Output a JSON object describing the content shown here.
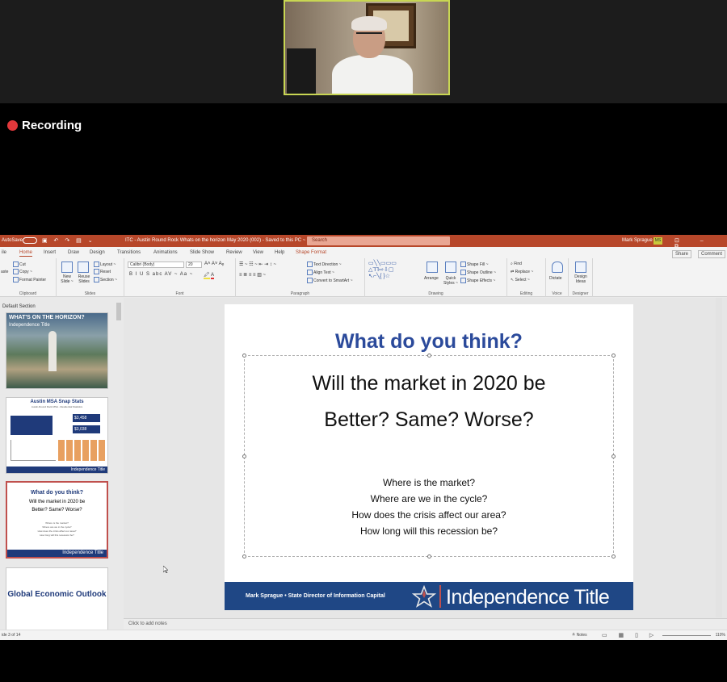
{
  "recording": {
    "label": "Recording"
  },
  "titlebar": {
    "autosave": "AutoSave",
    "doc_title": "ITC - Austin Round Rock Whats on the horizon May 2020 (002) - Saved to this PC ~",
    "search_placeholder": "Search",
    "user": "Mark Sprague",
    "initials": "MS"
  },
  "menu": {
    "items": [
      "ile",
      "Home",
      "Insert",
      "Draw",
      "Design",
      "Transitions",
      "Animations",
      "Slide Show",
      "Review",
      "View",
      "Help",
      "Shape Format"
    ],
    "active": "Home",
    "share": "Share",
    "comments": "Comment"
  },
  "ribbon": {
    "clipboard": {
      "label": "Clipboard",
      "cut": "Cut",
      "copy": "Copy ~",
      "paste": "aste",
      "format_painter": "Format Painter"
    },
    "slides": {
      "label": "Slides",
      "new_slide": "New Slide ~",
      "reuse": "Reuse Slides",
      "layout": "Layout ~",
      "reset": "Reset",
      "section": "Section ~"
    },
    "font": {
      "label": "Font",
      "font_name": "Calibri (Body)",
      "font_size": "20",
      "styles": "B I U S abc AV ~ Aa ~"
    },
    "paragraph": {
      "label": "Paragraph",
      "text_direction": "Text Direction ~",
      "align_text": "Align Text ~",
      "convert": "Convert to SmartArt ~"
    },
    "drawing": {
      "label": "Drawing",
      "arrange": "Arrange",
      "quick_styles": "Quick Styles ~",
      "shape_fill": "Shape Fill ~",
      "shape_outline": "Shape Outline ~",
      "shape_effects": "Shape Effects ~"
    },
    "editing": {
      "label": "Editing",
      "find": "Find",
      "replace": "Replace ~",
      "select": "Select ~"
    },
    "voice": {
      "label": "Voice",
      "dictate": "Dictate"
    },
    "designer": {
      "label": "Designer",
      "design_ideas": "Design Ideas"
    }
  },
  "thumbnails": {
    "section": "Default Section",
    "t1": {
      "title": "WHAT'S ON THE HORIZON?",
      "sub": "Independence Title"
    },
    "t2": {
      "title": "Austin MSA Snap Stats",
      "sub": "Austin-Round Rock MSA - Residential Statistics",
      "num1": "$3,458",
      "num2": "$3,038",
      "foot": "Independence Title"
    },
    "t3": {
      "title": "What do you think?",
      "l1": "Will the market in 2020 be",
      "l2": "Better? Same? Worse?",
      "s1": "Where is the market?",
      "s2": "Where are we in the cycle?",
      "s3": "How does the crisis affect our area?",
      "s4": "How long will this recession be?",
      "foot": "Independence Title"
    },
    "t4": {
      "title": "Global Economic Outlook"
    },
    "numbers": [
      "",
      "",
      "",
      ""
    ]
  },
  "slide": {
    "title": "What do you think?",
    "question_line1": "Will the market in 2020 be",
    "question_line2": "Better? Same? Worse?",
    "sub_lines": [
      "Where is the market?",
      "Where are we in the cycle?",
      "How does the crisis affect our area?",
      "How long will this recession be?"
    ],
    "footer_name": "Mark Sprague • State Director of Information Capital",
    "footer_brand": "Independence Title"
  },
  "notes": {
    "placeholder": "Click to add notes"
  },
  "status": {
    "slide_count": "ide 3 of 14",
    "notes": "Notes",
    "zoom": "110%"
  },
  "colors": {
    "accent": "#b7472a",
    "slide_blue": "#2b4a9b",
    "footer_navy": "#1f4785",
    "recording_red": "#e0383b"
  }
}
